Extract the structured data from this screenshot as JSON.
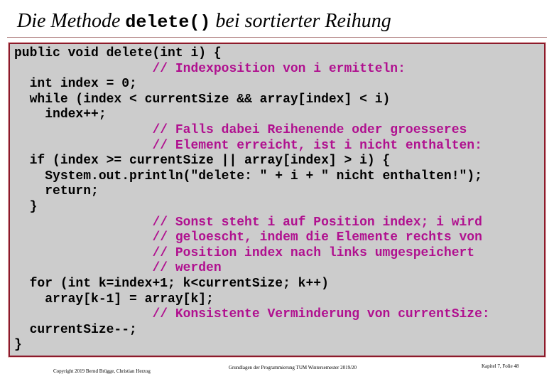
{
  "slide": {
    "title_prefix": "Die Methode ",
    "title_code": "delete()",
    "title_suffix": " bei sortierter Reihung"
  },
  "code_lines": [
    {
      "indent": "",
      "code": "public void delete(int i) {",
      "comment": ""
    },
    {
      "indent": "                  ",
      "code": "",
      "comment": "// Indexposition von i ermitteln:"
    },
    {
      "indent": "  ",
      "code": "int index = 0;",
      "comment": ""
    },
    {
      "indent": "  ",
      "code": "while (index < currentSize && array[index] < i)",
      "comment": ""
    },
    {
      "indent": "    ",
      "code": "index++;",
      "comment": ""
    },
    {
      "indent": "                  ",
      "code": "",
      "comment": "// Falls dabei Reihenende oder groesseres"
    },
    {
      "indent": "                  ",
      "code": "",
      "comment": "// Element erreicht, ist i nicht enthalten:"
    },
    {
      "indent": "  ",
      "code": "if (index >= currentSize || array[index] > i) {",
      "comment": ""
    },
    {
      "indent": "    ",
      "code": "System.out.println(\"delete: \" + i + \" nicht enthalten!\");",
      "comment": ""
    },
    {
      "indent": "    ",
      "code": "return;",
      "comment": ""
    },
    {
      "indent": "  ",
      "code": "}",
      "comment": ""
    },
    {
      "indent": "                  ",
      "code": "",
      "comment": "// Sonst steht i auf Position index; i wird"
    },
    {
      "indent": "                  ",
      "code": "",
      "comment": "// geloescht, indem die Elemente rechts von"
    },
    {
      "indent": "                  ",
      "code": "",
      "comment": "// Position index nach links umgespeichert"
    },
    {
      "indent": "                  ",
      "code": "",
      "comment": "// werden"
    },
    {
      "indent": "  ",
      "code": "for (int k=index+1; k<currentSize; k++)",
      "comment": ""
    },
    {
      "indent": "    ",
      "code": "array[k-1] = array[k];",
      "comment": ""
    },
    {
      "indent": "                  ",
      "code": "",
      "comment": "// Konsistente Verminderung von currentSize:"
    },
    {
      "indent": "  ",
      "code": "currentSize--;",
      "comment": ""
    },
    {
      "indent": "",
      "code": "}",
      "comment": ""
    }
  ],
  "footer": {
    "left": "Copyright 2019 Bernd Brügge, Christian Herzog",
    "center": "Grundlagen der Programmierung  TUM Wintersemester 2019/20",
    "right": "Kapitel 7, Folie 48"
  },
  "colors": {
    "comment": "#b0108f",
    "box_background": "#cccccc",
    "box_border": "#8b1a2b"
  }
}
